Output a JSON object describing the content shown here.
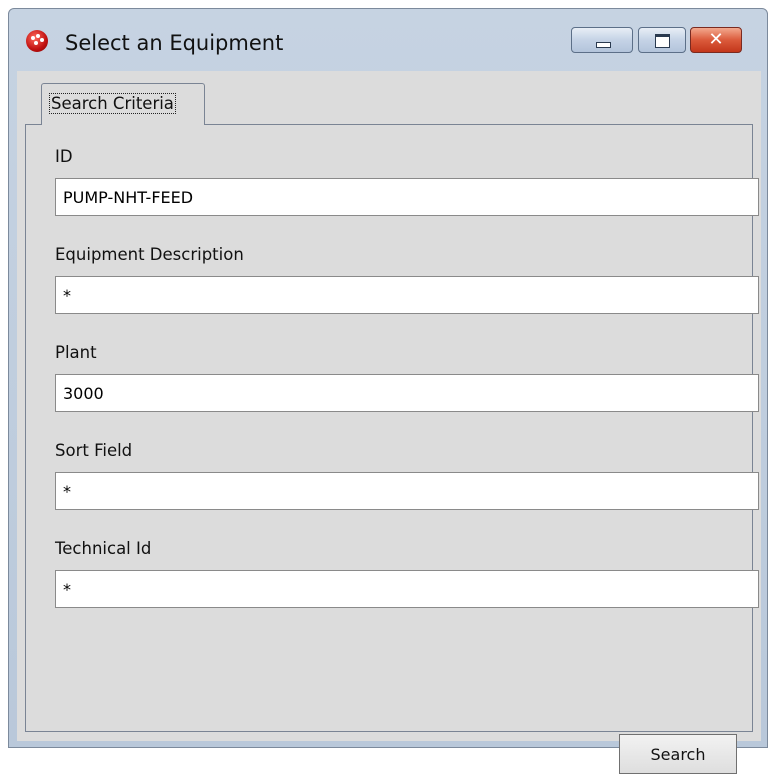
{
  "window": {
    "title": "Select an Equipment",
    "close_glyph": "✕"
  },
  "tabs": [
    {
      "label": "Search Criteria"
    }
  ],
  "form": {
    "fields": [
      {
        "label": "ID",
        "value": "PUMP-NHT-FEED"
      },
      {
        "label": "Equipment Description",
        "value": "*"
      },
      {
        "label": "Plant",
        "value": "3000"
      },
      {
        "label": "Sort Field",
        "value": "*"
      },
      {
        "label": "Technical Id",
        "value": "*"
      }
    ],
    "search_label": "Search"
  },
  "icons": {
    "app": "app-logo-icon",
    "minimize": "minimize-icon",
    "maximize": "maximize-icon",
    "close": "close-icon"
  },
  "colors": {
    "title_bar": "#c6d3e2",
    "client_background": "#dcdcdc",
    "close_button": "#db5a3b"
  }
}
